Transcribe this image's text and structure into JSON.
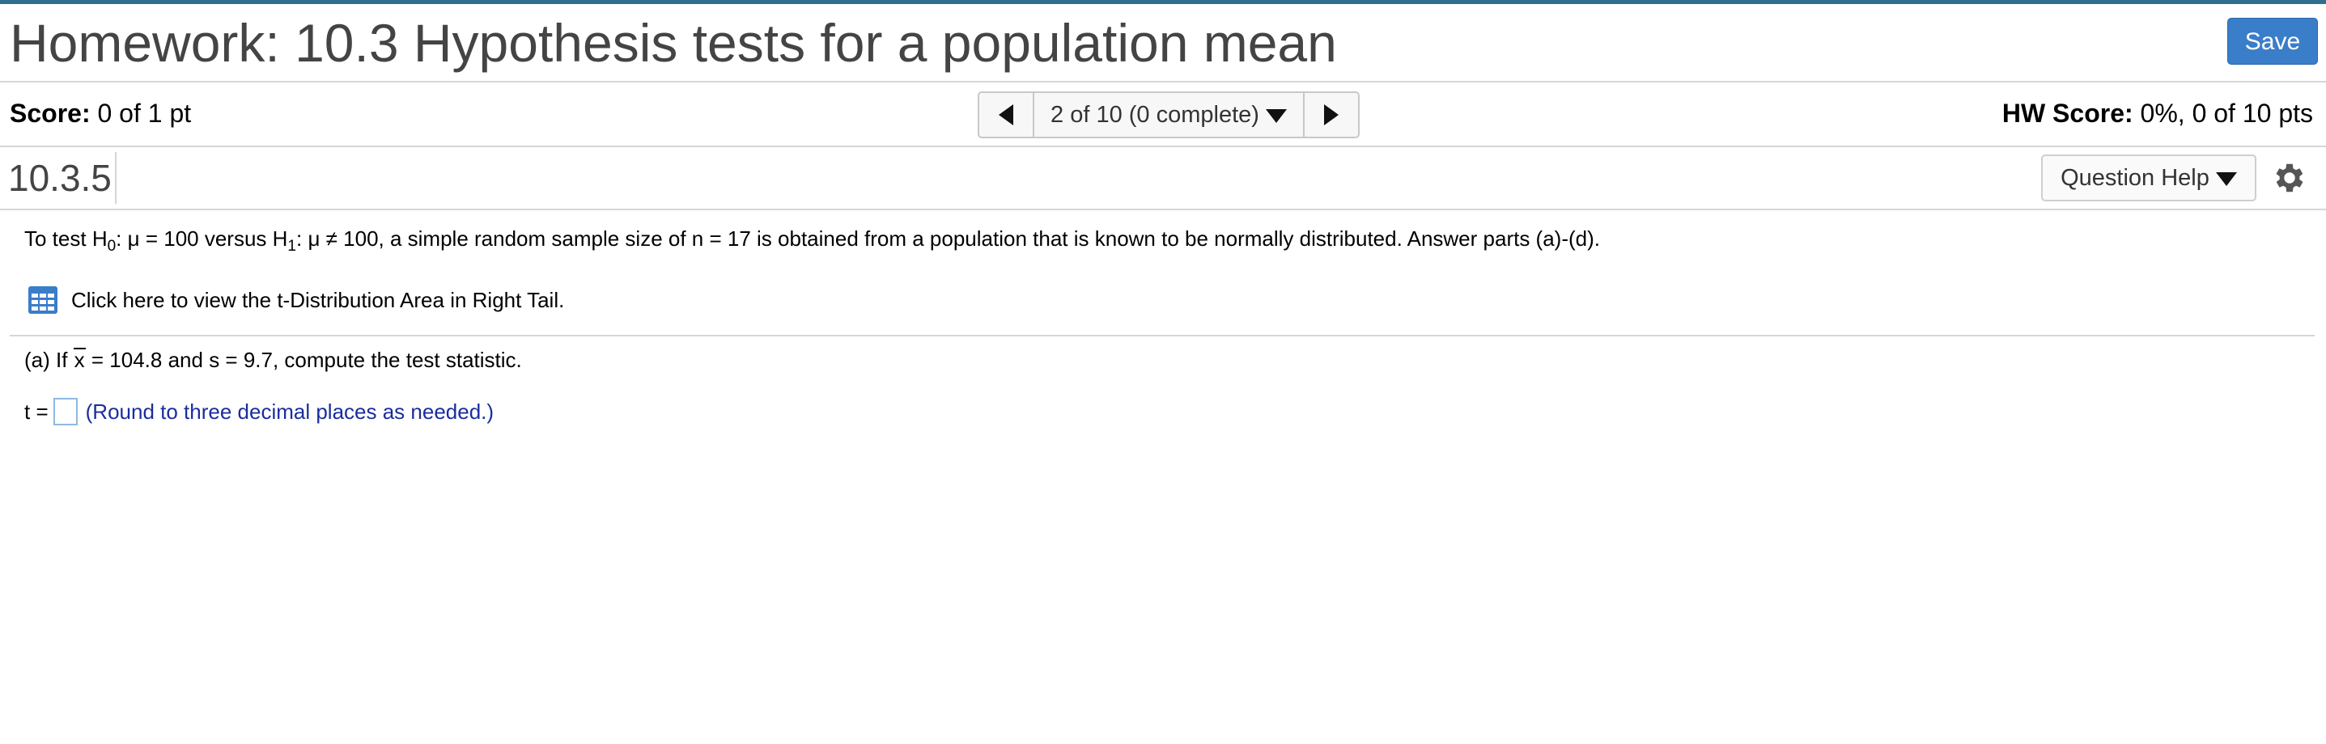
{
  "header": {
    "title": "Homework: 10.3 Hypothesis tests for a population mean",
    "save_label": "Save",
    "accent_color": "#2e6f8e",
    "save_color": "#3a7dc9"
  },
  "score_bar": {
    "score_label": "Score:",
    "score_value": "0 of 1 pt",
    "nav_label": "2 of 10 (0 complete)",
    "hw_score_label": "HW Score:",
    "hw_score_value": "0%, 0 of 10 pts"
  },
  "question_bar": {
    "number": "10.3.5",
    "help_label": "Question Help"
  },
  "question": {
    "intro_prefix": "To test H",
    "intro_sub0": "0",
    "intro_mid1": ": μ = 100 versus H",
    "intro_sub1": "1",
    "intro_rest": ": μ ≠ 100, a simple random sample size of n = 17 is obtained from a population that is known to be normally distributed. Answer parts (a)-(d).",
    "table_link": "Click here to view the t-Distribution Area in Right Tail.",
    "part_a_prefix": "(a) If ",
    "part_a_x": "x",
    "part_a_rest": " = 104.8 and s = 9.7, compute the test statistic.",
    "answer_label": "t =",
    "answer_value": "",
    "hint": "(Round to three decimal places as needed.)",
    "hint_color": "#1a2d9e"
  }
}
